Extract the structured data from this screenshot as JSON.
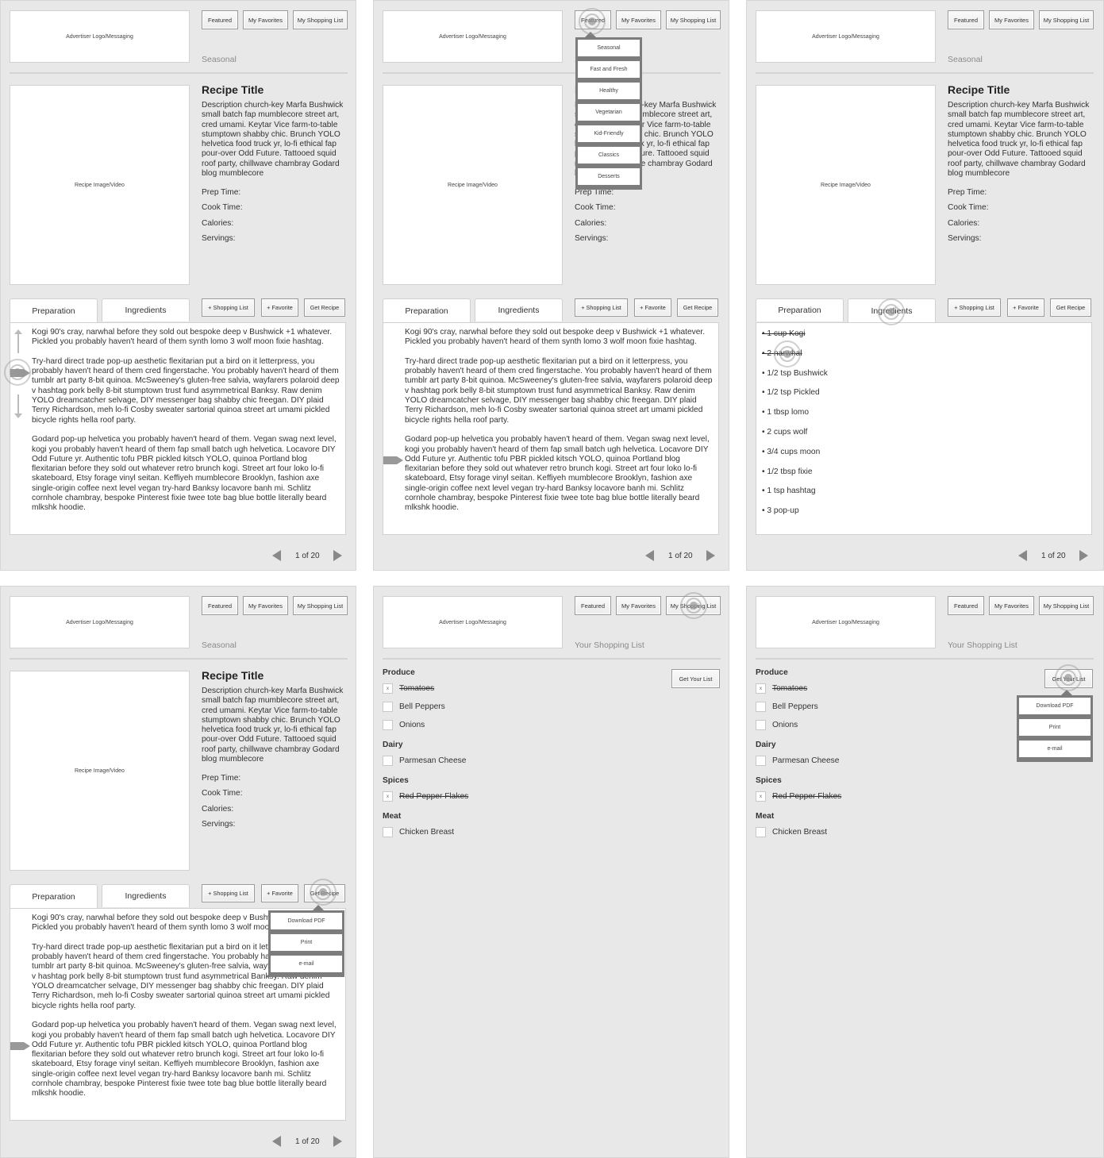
{
  "common": {
    "ad_label": "Advertiser Logo/Messaging",
    "nav": {
      "featured": "Featured",
      "favorites": "My Favorites",
      "shopping_list": "My Shopping List"
    },
    "media_label": "Recipe Image/Video"
  },
  "recipe": {
    "section": "Seasonal",
    "title": "Recipe Title",
    "description": "Description church-key Marfa Bushwick small batch fap mumblecore street art, cred umami. Keytar Vice farm-to-table stumptown shabby chic. Brunch YOLO helvetica food truck yr, lo-fi ethical fap pour-over Odd Future. Tattooed squid roof party, chillwave chambray Godard blog mumblecore",
    "prep_time_label": "Prep Time:",
    "cook_time_label": "Cook Time:",
    "calories_label": "Calories:",
    "servings_label": "Servings:",
    "tabs": {
      "preparation": "Preparation",
      "ingredients": "Ingredients"
    },
    "actions": {
      "add_shopping": "+ Shopping List",
      "add_favorite": "+ Favorite",
      "get_recipe": "Get Recipe"
    },
    "preparation": [
      "Kogi 90's cray, narwhal before they sold out bespoke deep v Bushwick +1 whatever. Pickled you probably haven't heard of them synth lomo 3 wolf moon fixie hashtag.",
      "Try-hard direct trade pop-up aesthetic flexitarian put a bird on it letterpress, you probably haven't heard of them cred fingerstache. You probably haven't heard of them tumblr art party 8-bit quinoa. McSweeney's gluten-free salvia, wayfarers polaroid deep",
      "v hashtag pork belly 8-bit stumptown trust fund asymmetrical Banksy. Raw denim YOLO dreamcatcher selvage, DIY messenger bag shabby chic freegan. DIY plaid Terry Richardson, meh lo-fi Cosby sweater sartorial quinoa street art umami pickled bicycle rights hella roof party.",
      "Godard pop-up helvetica you probably haven't heard of them. Vegan swag next level, kogi you probably haven't heard of them fap small batch ugh helvetica. Locavore DIY Odd Future yr. Authentic tofu PBR pickled kitsch YOLO, quinoa Portland blog flexitarian before they sold out whatever retro brunch kogi. Street art four loko lo-fi skateboard, Etsy forage vinyl seitan. Keffiyeh mumblecore Brooklyn, fashion axe single-origin coffee next level vegan try-hard Banksy locavore banh mi. Schlitz cornhole chambray, bespoke Pinterest fixie twee tote bag blue bottle literally beard mlkshk hoodie."
    ],
    "ingredients": [
      {
        "text": "1 cup Kogi",
        "checked": true
      },
      {
        "text": "2 narwhal",
        "checked": true
      },
      {
        "text": "1/2 tsp Bushwick",
        "checked": false
      },
      {
        "text": "1/2 tsp Pickled",
        "checked": false
      },
      {
        "text": "1 tbsp lomo",
        "checked": false
      },
      {
        "text": "2 cups wolf",
        "checked": false
      },
      {
        "text": "3/4 cups moon",
        "checked": false
      },
      {
        "text": "1/2 tbsp fixie",
        "checked": false
      },
      {
        "text": "1 tsp hashtag",
        "checked": false
      },
      {
        "text": "3 pop-up",
        "checked": false
      }
    ],
    "pager": {
      "current": 1,
      "total": 20,
      "label": "1 of 20"
    }
  },
  "featured_menu": [
    "Seasonal",
    "Fast and Fresh",
    "Healthy",
    "Vegetarian",
    "Kid-Friendly",
    "Classics",
    "Desserts"
  ],
  "export_menu": [
    "Download PDF",
    "Print",
    "e-mail"
  ],
  "shopping": {
    "section": "Your Shopping List",
    "get_list_label": "Get Your List",
    "check_mark": "x",
    "categories": [
      {
        "name": "Produce",
        "items": [
          {
            "text": "Tomatoes",
            "checked": true
          },
          {
            "text": "Bell Peppers",
            "checked": false
          },
          {
            "text": "Onions",
            "checked": false
          }
        ]
      },
      {
        "name": "Dairy",
        "items": [
          {
            "text": "Parmesan Cheese",
            "checked": false
          }
        ]
      },
      {
        "name": "Spices",
        "items": [
          {
            "text": "Red Pepper Flakes",
            "checked": true
          }
        ]
      },
      {
        "name": "Meat",
        "items": [
          {
            "text": "Chicken Breast",
            "checked": false
          }
        ]
      }
    ]
  },
  "colors": {
    "panel_bg": "#e8e8e8",
    "menu_frame": "#7c7c7c",
    "card_bg": "#ffffff",
    "muted_text": "#8a8a8a"
  }
}
